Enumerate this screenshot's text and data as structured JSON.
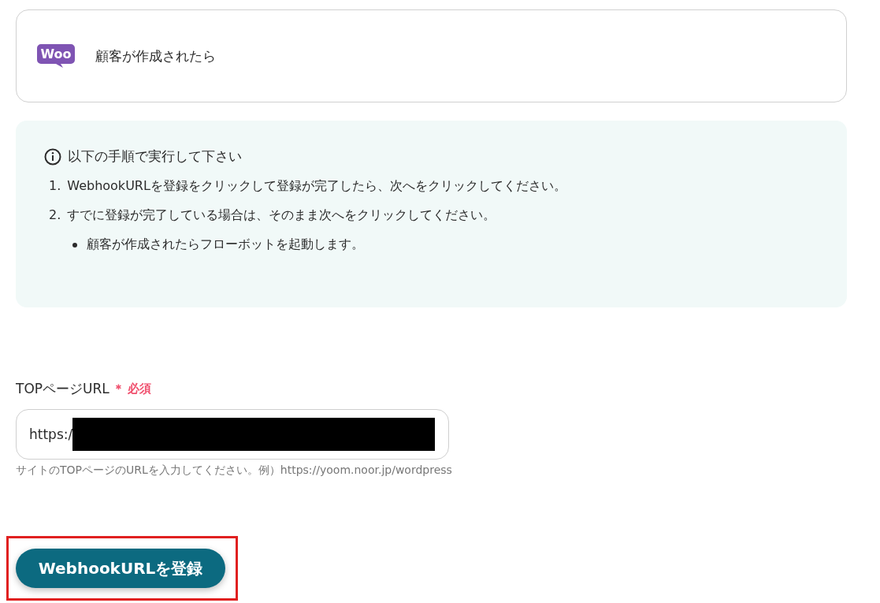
{
  "trigger": {
    "logo_text": "Woo",
    "label": "顧客が作成されたら"
  },
  "info": {
    "title": "以下の手順で実行して下さい",
    "steps": [
      {
        "number": "1.",
        "text": "WebhookURLを登録をクリックして登録が完了したら、次へをクリックしてください。"
      },
      {
        "number": "2.",
        "text": "すでに登録が完了している場合は、そのまま次へをクリックしてください。"
      }
    ],
    "bullets": [
      "顧客が作成されたらフローボットを起動します。"
    ]
  },
  "field": {
    "label": "TOPページURL",
    "required_mark": "＊",
    "required": "必須",
    "value": "https:/",
    "redacted": true,
    "hint": "サイトのTOPページのURLを入力してください。例）https://yoom.noor.jp/wordpress"
  },
  "button": {
    "label": "WebhookURLを登録",
    "highlighted": true
  }
}
